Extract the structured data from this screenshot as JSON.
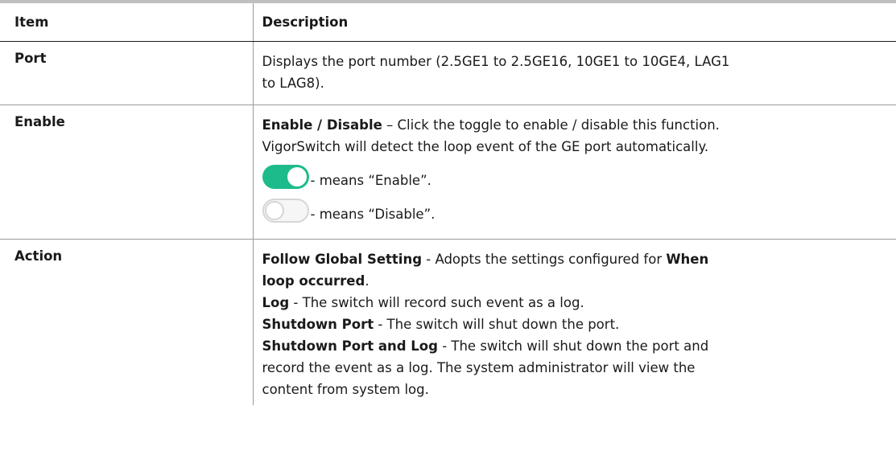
{
  "table": {
    "headers": {
      "item": "Item",
      "description": "Description"
    },
    "rows": {
      "port": {
        "item": "Port",
        "desc_line1": "Displays the port number (2.5GE1 to 2.5GE16, 10GE1 to 10GE4, LAG1",
        "desc_line2": "to LAG8)."
      },
      "enable": {
        "item": "Enable",
        "bold": "Enable / Disable",
        "line1_rest": " – Click the toggle to enable / disable this function.",
        "line2": "VigorSwitch will detect the loop event of the GE port automatically.",
        "toggle_on_text": "- means “Enable”.",
        "toggle_off_text": "- means “Disable”.",
        "toggle_on_color": "#1dbb8b",
        "toggle_off_color": "#d6d6d6"
      },
      "action": {
        "item": "Action",
        "follow_bold": "Follow Global Setting",
        "follow_rest": " - Adopts the settings configured for ",
        "follow_bold2": "When",
        "follow_bold3": "loop occurred",
        "follow_end": ".",
        "log_bold": "Log",
        "log_rest": " - The switch will record such event as a log.",
        "shutdown_bold": "Shutdown Port",
        "shutdown_rest": " - The switch will shut down the port.",
        "sdlog_bold": "Shutdown Port and Log",
        "sdlog_rest1": " - The switch will shut down the port and",
        "sdlog_rest2": "record the event as a log. The system administrator will view the",
        "sdlog_rest3": "content from system log."
      }
    }
  }
}
